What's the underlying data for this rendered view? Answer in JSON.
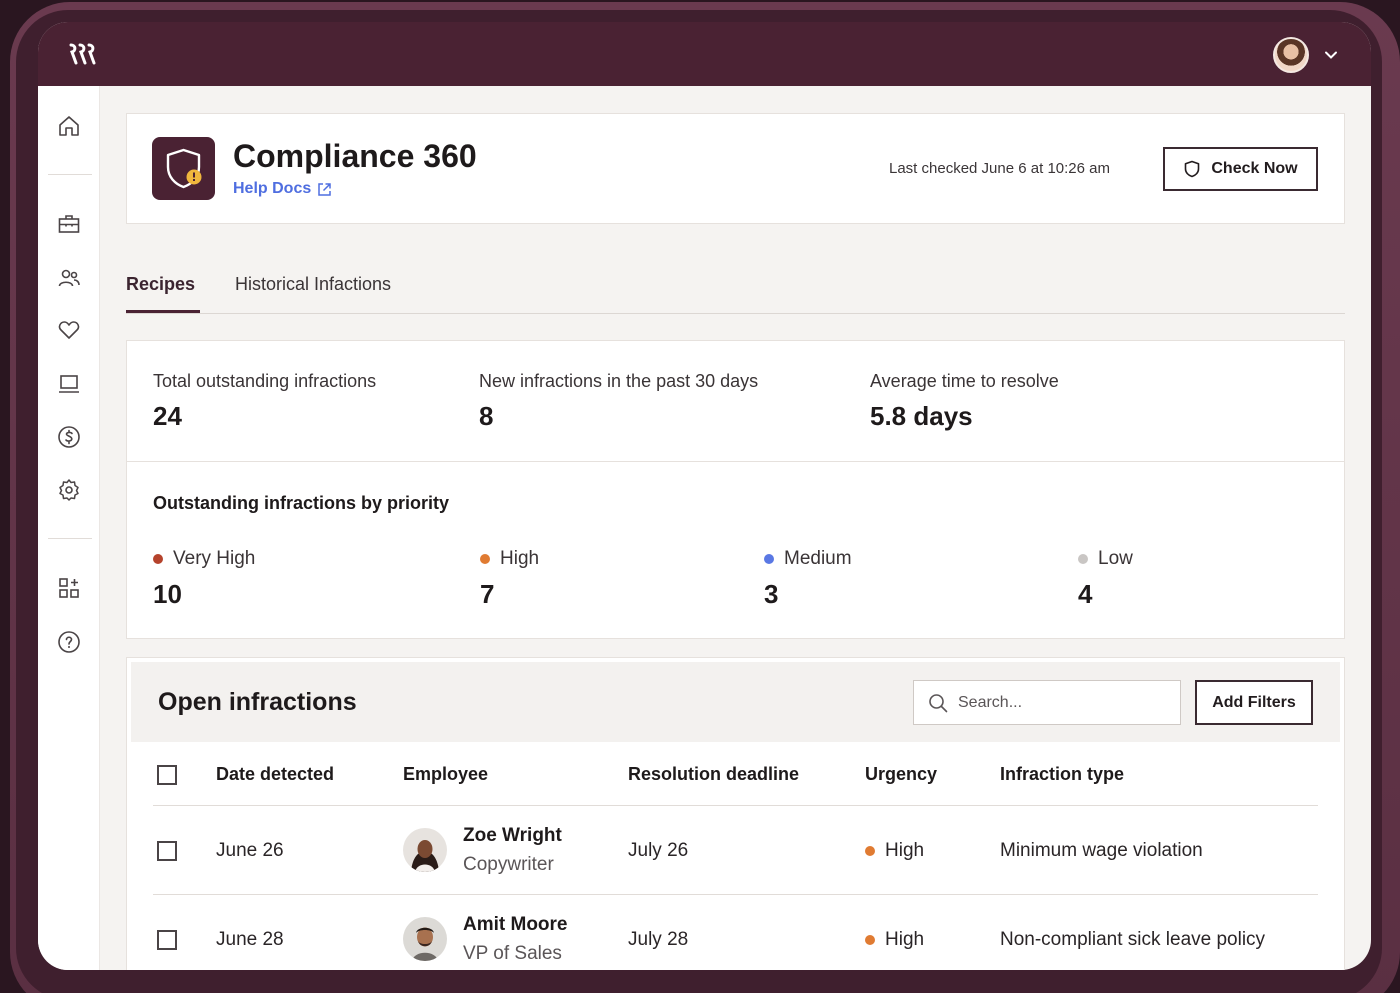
{
  "app": {
    "logo_text": "ꭆ",
    "title": "Compliance 360",
    "help_link": "Help Docs",
    "last_checked": "Last checked June 6 at 10:26 am",
    "check_now_label": "Check Now"
  },
  "sidebar": {
    "items": [
      {
        "icon": "home-icon"
      },
      {
        "icon": "briefcase-icon"
      },
      {
        "icon": "people-icon"
      },
      {
        "icon": "heart-icon"
      },
      {
        "icon": "laptop-icon"
      },
      {
        "icon": "dollar-icon"
      },
      {
        "icon": "settings-icon"
      },
      {
        "icon": "apps-add-icon"
      },
      {
        "icon": "help-icon"
      }
    ]
  },
  "tabs": [
    {
      "label": "Recipes",
      "active": true
    },
    {
      "label": "Historical Infactions",
      "active": false
    }
  ],
  "stats": {
    "total_label": "Total outstanding infractions",
    "total_value": "24",
    "new_label": "New infractions in the past 30 days",
    "new_value": "8",
    "avg_label": "Average time to resolve",
    "avg_value": "5.8 days"
  },
  "priority": {
    "title": "Outstanding infractions by priority",
    "items": [
      {
        "label": "Very High",
        "value": "10",
        "color": "#b5432c"
      },
      {
        "label": "High",
        "value": "7",
        "color": "#e07b32"
      },
      {
        "label": "Medium",
        "value": "3",
        "color": "#5a78e4"
      },
      {
        "label": "Low",
        "value": "4",
        "color": "#c9c6c4"
      }
    ]
  },
  "table": {
    "title": "Open infractions",
    "search_placeholder": "Search...",
    "add_filters_label": "Add Filters",
    "columns": [
      "Date detected",
      "Employee",
      "Resolution deadline",
      "Urgency",
      "Infraction type"
    ],
    "rows": [
      {
        "date": "June 26",
        "name": "Zoe Wright",
        "role": "Copywriter",
        "deadline": "July 26",
        "urgency": "High",
        "urgency_color": "#e07b32",
        "type": "Minimum wage violation"
      },
      {
        "date": "June 28",
        "name": "Amit Moore",
        "role": "VP of Sales",
        "deadline": "July 28",
        "urgency": "High",
        "urgency_color": "#e07b32",
        "type": "Non-compliant sick leave policy"
      }
    ]
  }
}
